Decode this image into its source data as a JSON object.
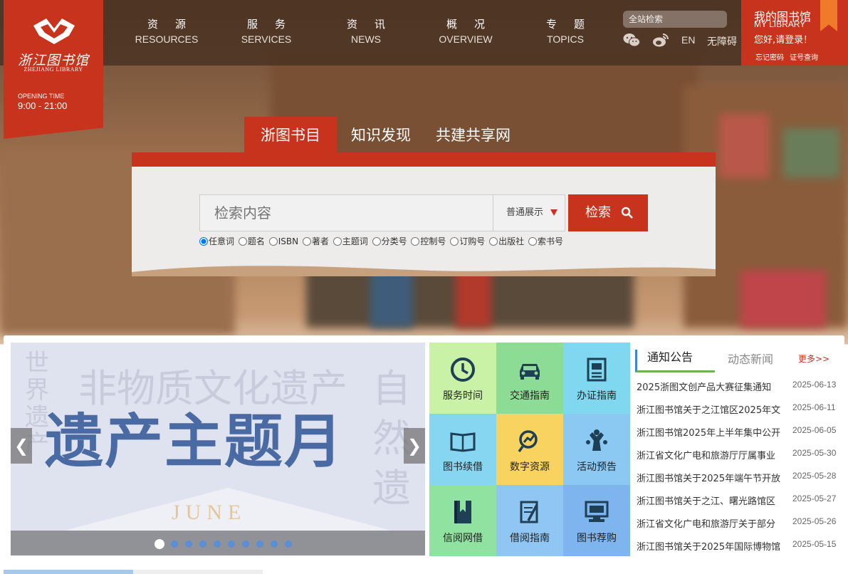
{
  "colors": {
    "brand_red": "#c8331d",
    "accent_orange": "#f07a2a"
  },
  "logo": {
    "cn": "浙江图书馆",
    "en": "ZHEJIANG LIBRARY",
    "open_label": "OPENING TIME",
    "open_time": "9:00 - 21:00"
  },
  "nav": [
    {
      "cn": "资源",
      "en": "RESOURCES"
    },
    {
      "cn": "服务",
      "en": "SERVICES"
    },
    {
      "cn": "资讯",
      "en": "NEWS"
    },
    {
      "cn": "概况",
      "en": "OVERVIEW"
    },
    {
      "cn": "专题",
      "en": "TOPICS"
    }
  ],
  "header": {
    "search_placeholder": "全站检索",
    "en_label": "EN",
    "accessibility_label": "无障碍",
    "icons": [
      "wechat-icon",
      "weibo-icon"
    ]
  },
  "mylib": {
    "cn": "我的图书馆",
    "en": "MY LIBRARY",
    "login": "您好,请登录！",
    "forget": "忘记密码",
    "card": "证号查询"
  },
  "search": {
    "tabs": [
      "浙图书目",
      "知识发现",
      "共建共享网"
    ],
    "placeholder": "检索内容",
    "mode": "普通展示",
    "button": "检索",
    "filters": [
      "任意词",
      "题名",
      "ISBN",
      "著者",
      "主题词",
      "分类号",
      "控制号",
      "订购号",
      "出版社",
      "索书号"
    ],
    "selected_filter": "任意词"
  },
  "banner": {
    "title": "遗产主题月",
    "subtitle": "JUNE",
    "slide_count": 10,
    "active_slide": 1
  },
  "tiles": [
    {
      "label": "服务时间",
      "icon": "clock-icon",
      "color": "#c9f2a6"
    },
    {
      "label": "交通指南",
      "icon": "car-icon",
      "color": "#8ddc95"
    },
    {
      "label": "办证指南",
      "icon": "card-icon",
      "color": "#7fd8ef"
    },
    {
      "label": "图书续借",
      "icon": "book-icon",
      "color": "#86d6f2"
    },
    {
      "label": "数字资源",
      "icon": "digital-icon",
      "color": "#f8d35f"
    },
    {
      "label": "活动预告",
      "icon": "people-icon",
      "color": "#8cc9f2"
    },
    {
      "label": "信阅网借",
      "icon": "bookmark-book-icon",
      "color": "#90e2a0"
    },
    {
      "label": "借阅指南",
      "icon": "guide-icon",
      "color": "#8fc6f3"
    },
    {
      "label": "图书荐购",
      "icon": "computer-icon",
      "color": "#7fb5ee"
    }
  ],
  "news": {
    "tab_active": "通知公告",
    "tab_other": "动态新闻",
    "more": "更多>>",
    "items": [
      {
        "title": "2025浙图文创产品大赛征集通知",
        "date": "2025-06-13"
      },
      {
        "title": "浙江图书馆关于之江馆区2025年文",
        "date": "2025-06-11"
      },
      {
        "title": "浙江图书馆2025年上半年集中公开",
        "date": "2025-06-05"
      },
      {
        "title": "浙江省文化广电和旅游厅厅属事业",
        "date": "2025-05-30"
      },
      {
        "title": "浙江图书馆关于2025年端午节开放",
        "date": "2025-05-28"
      },
      {
        "title": "浙江图书馆关于之江、曙光路馆区",
        "date": "2025-05-27"
      },
      {
        "title": "浙江省文化广电和旅游厅关于部分",
        "date": "2025-05-26"
      },
      {
        "title": "浙江图书馆关于2025年国际博物馆",
        "date": "2025-05-15"
      }
    ]
  }
}
